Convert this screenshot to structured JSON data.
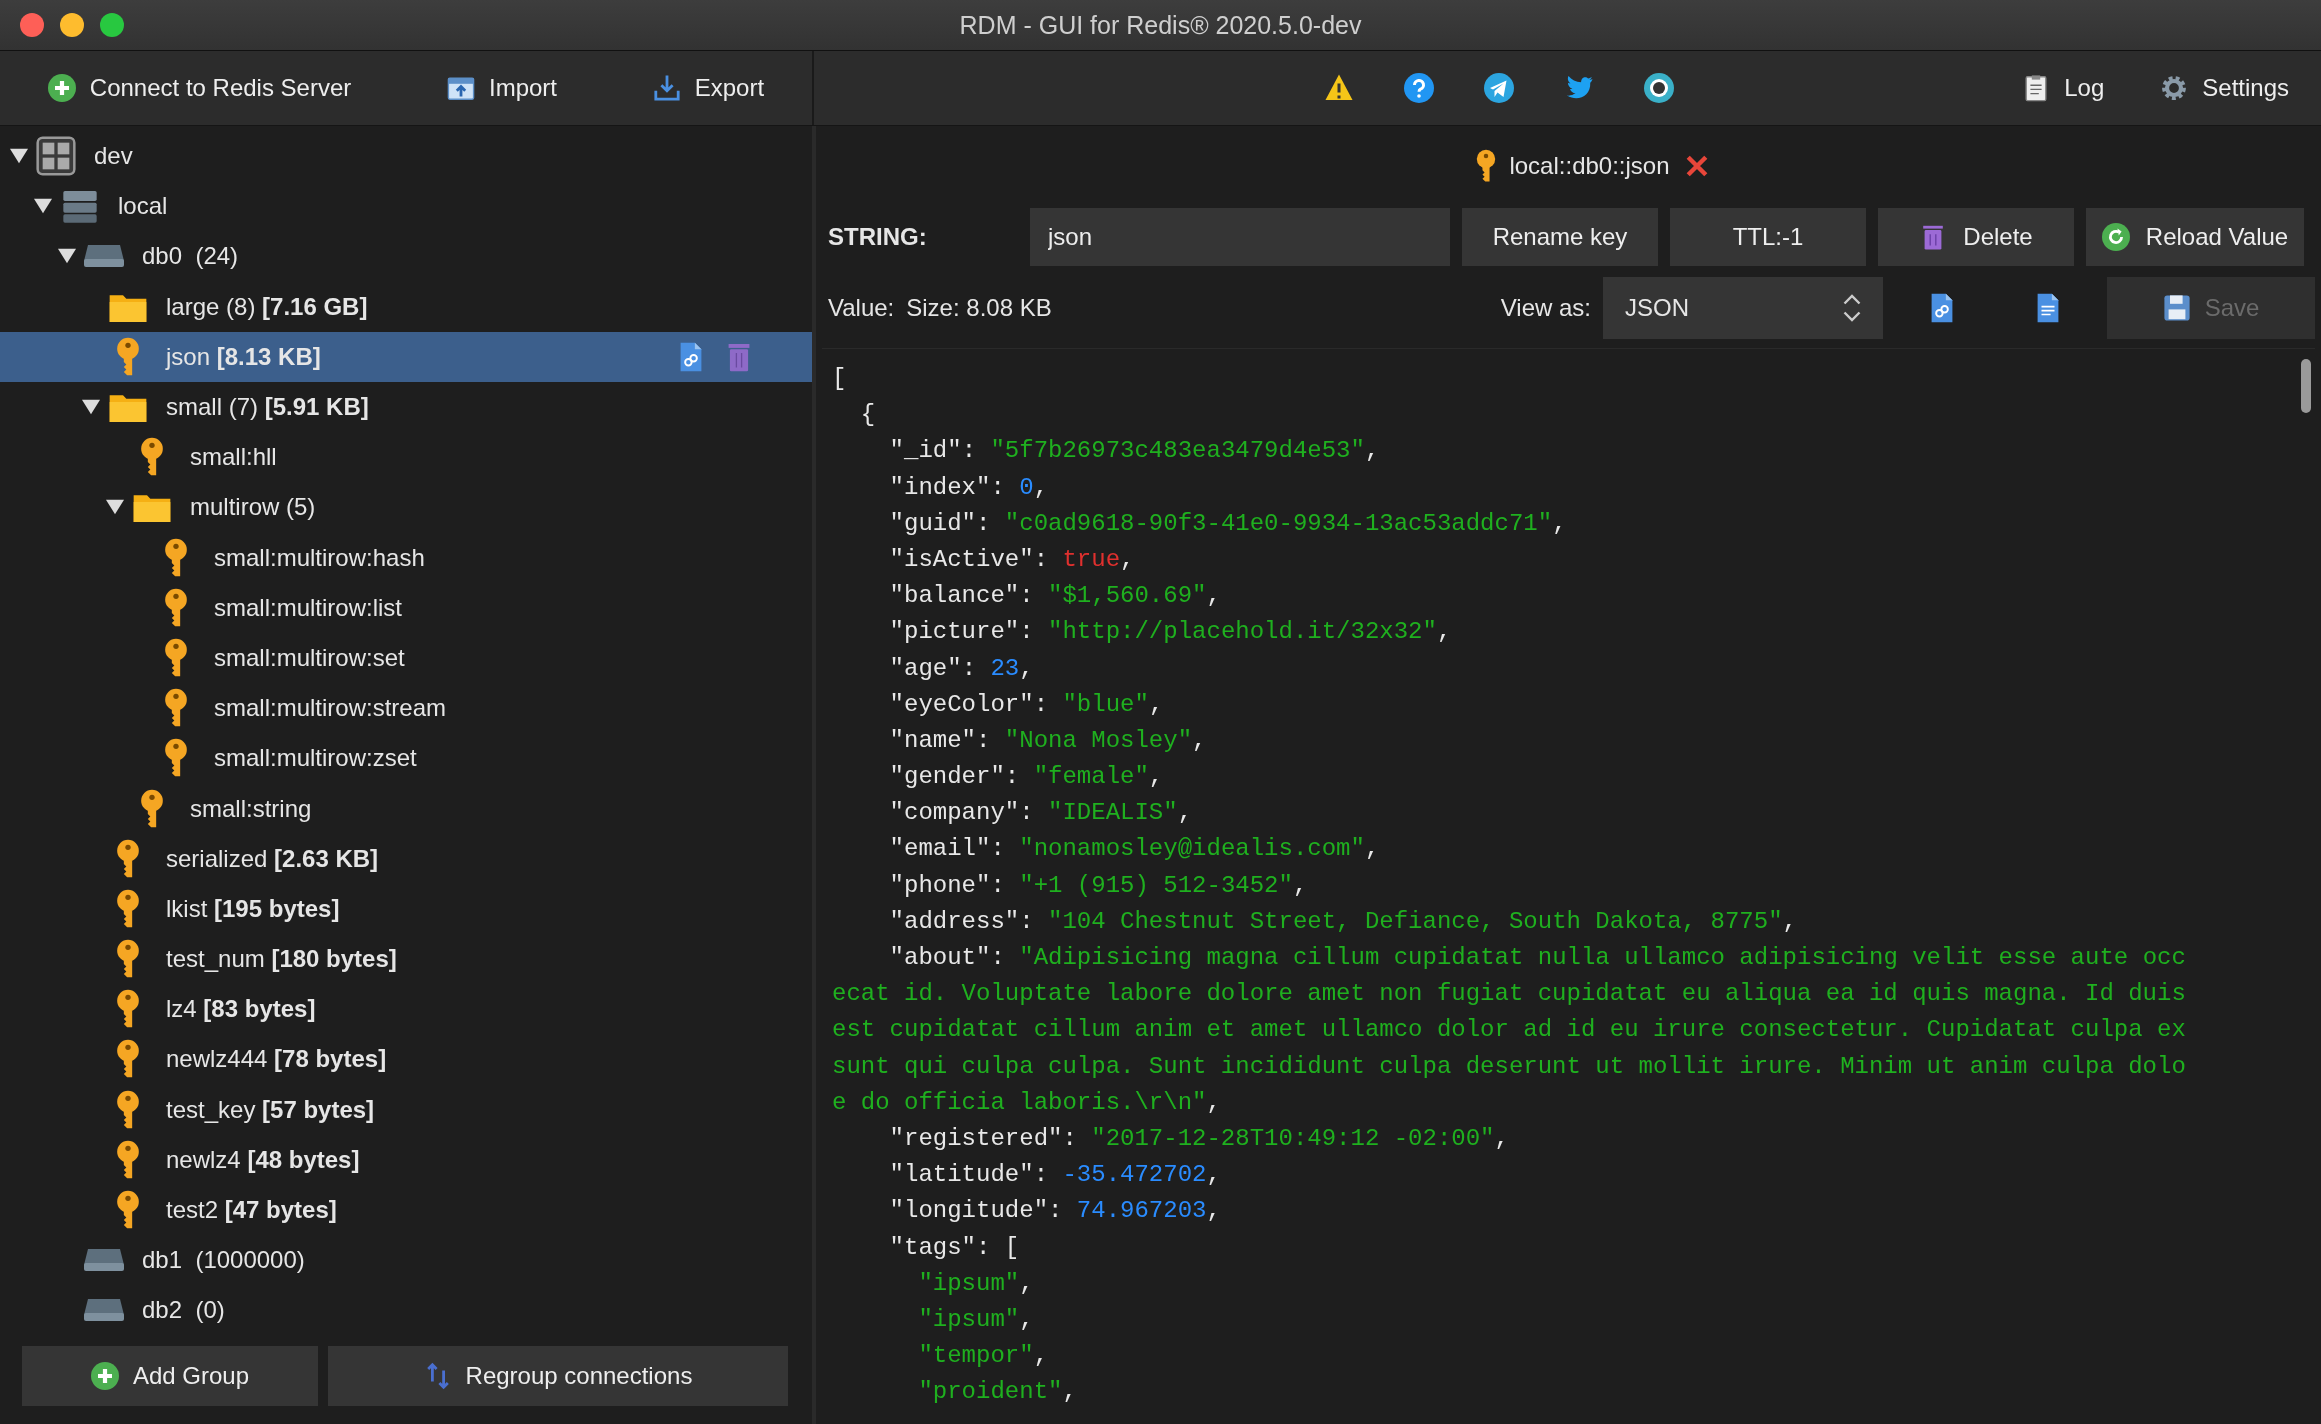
{
  "window": {
    "title": "RDM - GUI for Redis® 2020.5.0-dev"
  },
  "toolbar": {
    "left": [
      {
        "kind": "connect",
        "label": "Connect to Redis Server"
      },
      {
        "kind": "import",
        "label": "Import"
      },
      {
        "kind": "export",
        "label": "Export"
      }
    ],
    "center": [
      {
        "kind": "warning"
      },
      {
        "kind": "help"
      },
      {
        "kind": "telegram"
      },
      {
        "kind": "twitter"
      },
      {
        "kind": "github"
      }
    ],
    "right": [
      {
        "kind": "log",
        "label": "Log"
      },
      {
        "kind": "settings",
        "label": "Settings"
      }
    ]
  },
  "tree": [
    {
      "kind": "group",
      "name": "dev",
      "expanded": true,
      "selected": false,
      "children": [
        {
          "kind": "connection",
          "name": "local",
          "expanded": true,
          "selected": false,
          "children": [
            {
              "kind": "db",
              "name": "db0",
              "count": "(24)",
              "expanded": true,
              "selected": false,
              "children": [
                {
                  "kind": "folder",
                  "name": "large (8)",
                  "size": "[7.16 GB]",
                  "selected": false
                },
                {
                  "kind": "key",
                  "name": "json",
                  "size": "[8.13 KB]",
                  "selected": true
                },
                {
                  "kind": "folder",
                  "name": "small (7)",
                  "size": "[5.91 KB]",
                  "expanded": true,
                  "selected": false,
                  "children": [
                    {
                      "kind": "key",
                      "name": "small:hll",
                      "selected": false
                    },
                    {
                      "kind": "folder",
                      "name": "multirow (5)",
                      "expanded": true,
                      "selected": false,
                      "children": [
                        {
                          "kind": "key",
                          "name": "small:multirow:hash",
                          "selected": false
                        },
                        {
                          "kind": "key",
                          "name": "small:multirow:list",
                          "selected": false
                        },
                        {
                          "kind": "key",
                          "name": "small:multirow:set",
                          "selected": false
                        },
                        {
                          "kind": "key",
                          "name": "small:multirow:stream",
                          "selected": false
                        },
                        {
                          "kind": "key",
                          "name": "small:multirow:zset",
                          "selected": false
                        }
                      ]
                    },
                    {
                      "kind": "key",
                      "name": "small:string",
                      "selected": false
                    }
                  ]
                },
                {
                  "kind": "key",
                  "name": "serialized",
                  "size": "[2.63 KB]",
                  "selected": false
                },
                {
                  "kind": "key",
                  "name": "lkist",
                  "size": "[195 bytes]",
                  "selected": false
                },
                {
                  "kind": "key",
                  "name": "test_num",
                  "size": "[180 bytes]",
                  "selected": false
                },
                {
                  "kind": "key",
                  "name": "lz4",
                  "size": "[83 bytes]",
                  "selected": false
                },
                {
                  "kind": "key",
                  "name": "newlz444",
                  "size": "[78 bytes]",
                  "selected": false
                },
                {
                  "kind": "key",
                  "name": "test_key",
                  "size": "[57 bytes]",
                  "selected": false
                },
                {
                  "kind": "key",
                  "name": "newlz4",
                  "size": "[48 bytes]",
                  "selected": false
                },
                {
                  "kind": "key",
                  "name": "test2",
                  "size": "[47 bytes]",
                  "selected": false
                }
              ]
            },
            {
              "kind": "db",
              "name": "db1",
              "count": "(1000000)",
              "selected": false
            },
            {
              "kind": "db",
              "name": "db2",
              "count": "(0)",
              "selected": false
            }
          ]
        }
      ]
    }
  ],
  "sidebar_buttons": [
    {
      "kind": "add",
      "label": "Add Group"
    },
    {
      "kind": "regroup",
      "label": "Regroup connections"
    }
  ],
  "key_tab": {
    "title": "local::db0::json"
  },
  "key_header": {
    "type_label": "STRING:",
    "key_name": "json",
    "buttons": [
      {
        "kind": "rename",
        "label": "Rename key"
      },
      {
        "kind": "ttl",
        "label": "TTL:-1"
      },
      {
        "kind": "delete",
        "label": "Delete"
      },
      {
        "kind": "reload",
        "label": "Reload Value"
      }
    ]
  },
  "value_bar": {
    "label": "Value:",
    "size": "Size: 8.08 KB",
    "view_as_label": "View as:",
    "view_as": "JSON",
    "save": {
      "label": "Save",
      "disabled": true
    }
  },
  "editor_lines": [
    [
      {
        "kind": "punct",
        "text": "["
      }
    ],
    [
      {
        "kind": "punct",
        "text": "  {"
      }
    ],
    [
      {
        "kind": "key",
        "text": "    \"_id\""
      },
      {
        "kind": "punct",
        "text": ": "
      },
      {
        "kind": "string",
        "text": "\"5f7b26973c483ea3479d4e53\""
      },
      {
        "kind": "punct",
        "text": ","
      }
    ],
    [
      {
        "kind": "key",
        "text": "    \"index\""
      },
      {
        "kind": "punct",
        "text": ": "
      },
      {
        "kind": "number",
        "text": "0"
      },
      {
        "kind": "punct",
        "text": ","
      }
    ],
    [
      {
        "kind": "key",
        "text": "    \"guid\""
      },
      {
        "kind": "punct",
        "text": ": "
      },
      {
        "kind": "string",
        "text": "\"c0ad9618-90f3-41e0-9934-13ac53addc71\""
      },
      {
        "kind": "punct",
        "text": ","
      }
    ],
    [
      {
        "kind": "key",
        "text": "    \"isActive\""
      },
      {
        "kind": "punct",
        "text": ": "
      },
      {
        "kind": "boolean",
        "text": "true"
      },
      {
        "kind": "punct",
        "text": ","
      }
    ],
    [
      {
        "kind": "key",
        "text": "    \"balance\""
      },
      {
        "kind": "punct",
        "text": ": "
      },
      {
        "kind": "string",
        "text": "\"$1,560.69\""
      },
      {
        "kind": "punct",
        "text": ","
      }
    ],
    [
      {
        "kind": "key",
        "text": "    \"picture\""
      },
      {
        "kind": "punct",
        "text": ": "
      },
      {
        "kind": "string",
        "text": "\"http://placehold.it/32x32\""
      },
      {
        "kind": "punct",
        "text": ","
      }
    ],
    [
      {
        "kind": "key",
        "text": "    \"age\""
      },
      {
        "kind": "punct",
        "text": ": "
      },
      {
        "kind": "number",
        "text": "23"
      },
      {
        "kind": "punct",
        "text": ","
      }
    ],
    [
      {
        "kind": "key",
        "text": "    \"eyeColor\""
      },
      {
        "kind": "punct",
        "text": ": "
      },
      {
        "kind": "string",
        "text": "\"blue\""
      },
      {
        "kind": "punct",
        "text": ","
      }
    ],
    [
      {
        "kind": "key",
        "text": "    \"name\""
      },
      {
        "kind": "punct",
        "text": ": "
      },
      {
        "kind": "string",
        "text": "\"Nona Mosley\""
      },
      {
        "kind": "punct",
        "text": ","
      }
    ],
    [
      {
        "kind": "key",
        "text": "    \"gender\""
      },
      {
        "kind": "punct",
        "text": ": "
      },
      {
        "kind": "string",
        "text": "\"female\""
      },
      {
        "kind": "punct",
        "text": ","
      }
    ],
    [
      {
        "kind": "key",
        "text": "    \"company\""
      },
      {
        "kind": "punct",
        "text": ": "
      },
      {
        "kind": "string",
        "text": "\"IDEALIS\""
      },
      {
        "kind": "punct",
        "text": ","
      }
    ],
    [
      {
        "kind": "key",
        "text": "    \"email\""
      },
      {
        "kind": "punct",
        "text": ": "
      },
      {
        "kind": "string",
        "text": "\"nonamosley@idealis.com\""
      },
      {
        "kind": "punct",
        "text": ","
      }
    ],
    [
      {
        "kind": "key",
        "text": "    \"phone\""
      },
      {
        "kind": "punct",
        "text": ": "
      },
      {
        "kind": "string",
        "text": "\"+1 (915) 512-3452\""
      },
      {
        "kind": "punct",
        "text": ","
      }
    ],
    [
      {
        "kind": "key",
        "text": "    \"address\""
      },
      {
        "kind": "punct",
        "text": ": "
      },
      {
        "kind": "string",
        "text": "\"104 Chestnut Street, Defiance, South Dakota, 8775\""
      },
      {
        "kind": "punct",
        "text": ","
      }
    ],
    [
      {
        "kind": "key",
        "text": "    \"about\""
      },
      {
        "kind": "punct",
        "text": ": "
      },
      {
        "kind": "string",
        "text": "\"Adipisicing magna cillum cupidatat nulla ullamco adipisicing velit esse aute occ"
      }
    ],
    [
      {
        "kind": "string",
        "text": "ecat id. Voluptate labore dolore amet non fugiat cupidatat eu aliqua ea id quis magna. Id duis"
      }
    ],
    [
      {
        "kind": "string",
        "text": "est cupidatat cillum anim et amet ullamco dolor ad id eu irure consectetur. Cupidatat culpa ex"
      }
    ],
    [
      {
        "kind": "string",
        "text": "sunt qui culpa culpa. Sunt incididunt culpa deserunt ut mollit irure. Minim ut anim culpa dolo"
      }
    ],
    [
      {
        "kind": "string",
        "text": "e do officia laboris.\\r\\n\""
      },
      {
        "kind": "punct",
        "text": ","
      }
    ],
    [
      {
        "kind": "key",
        "text": "    \"registered\""
      },
      {
        "kind": "punct",
        "text": ": "
      },
      {
        "kind": "string",
        "text": "\"2017-12-28T10:49:12 -02:00\""
      },
      {
        "kind": "punct",
        "text": ","
      }
    ],
    [
      {
        "kind": "key",
        "text": "    \"latitude\""
      },
      {
        "kind": "punct",
        "text": ": "
      },
      {
        "kind": "number",
        "text": "-35.472702"
      },
      {
        "kind": "punct",
        "text": ","
      }
    ],
    [
      {
        "kind": "key",
        "text": "    \"longitude\""
      },
      {
        "kind": "punct",
        "text": ": "
      },
      {
        "kind": "number",
        "text": "74.967203"
      },
      {
        "kind": "punct",
        "text": ","
      }
    ],
    [
      {
        "kind": "key",
        "text": "    \"tags\""
      },
      {
        "kind": "punct",
        "text": ": ["
      }
    ],
    [
      {
        "kind": "string",
        "text": "      \"ipsum\""
      },
      {
        "kind": "punct",
        "text": ","
      }
    ],
    [
      {
        "kind": "string",
        "text": "      \"ipsum\""
      },
      {
        "kind": "punct",
        "text": ","
      }
    ],
    [
      {
        "kind": "string",
        "text": "      \"tempor\""
      },
      {
        "kind": "punct",
        "text": ","
      }
    ],
    [
      {
        "kind": "string",
        "text": "      \"proident\""
      },
      {
        "kind": "punct",
        "text": ","
      }
    ]
  ]
}
